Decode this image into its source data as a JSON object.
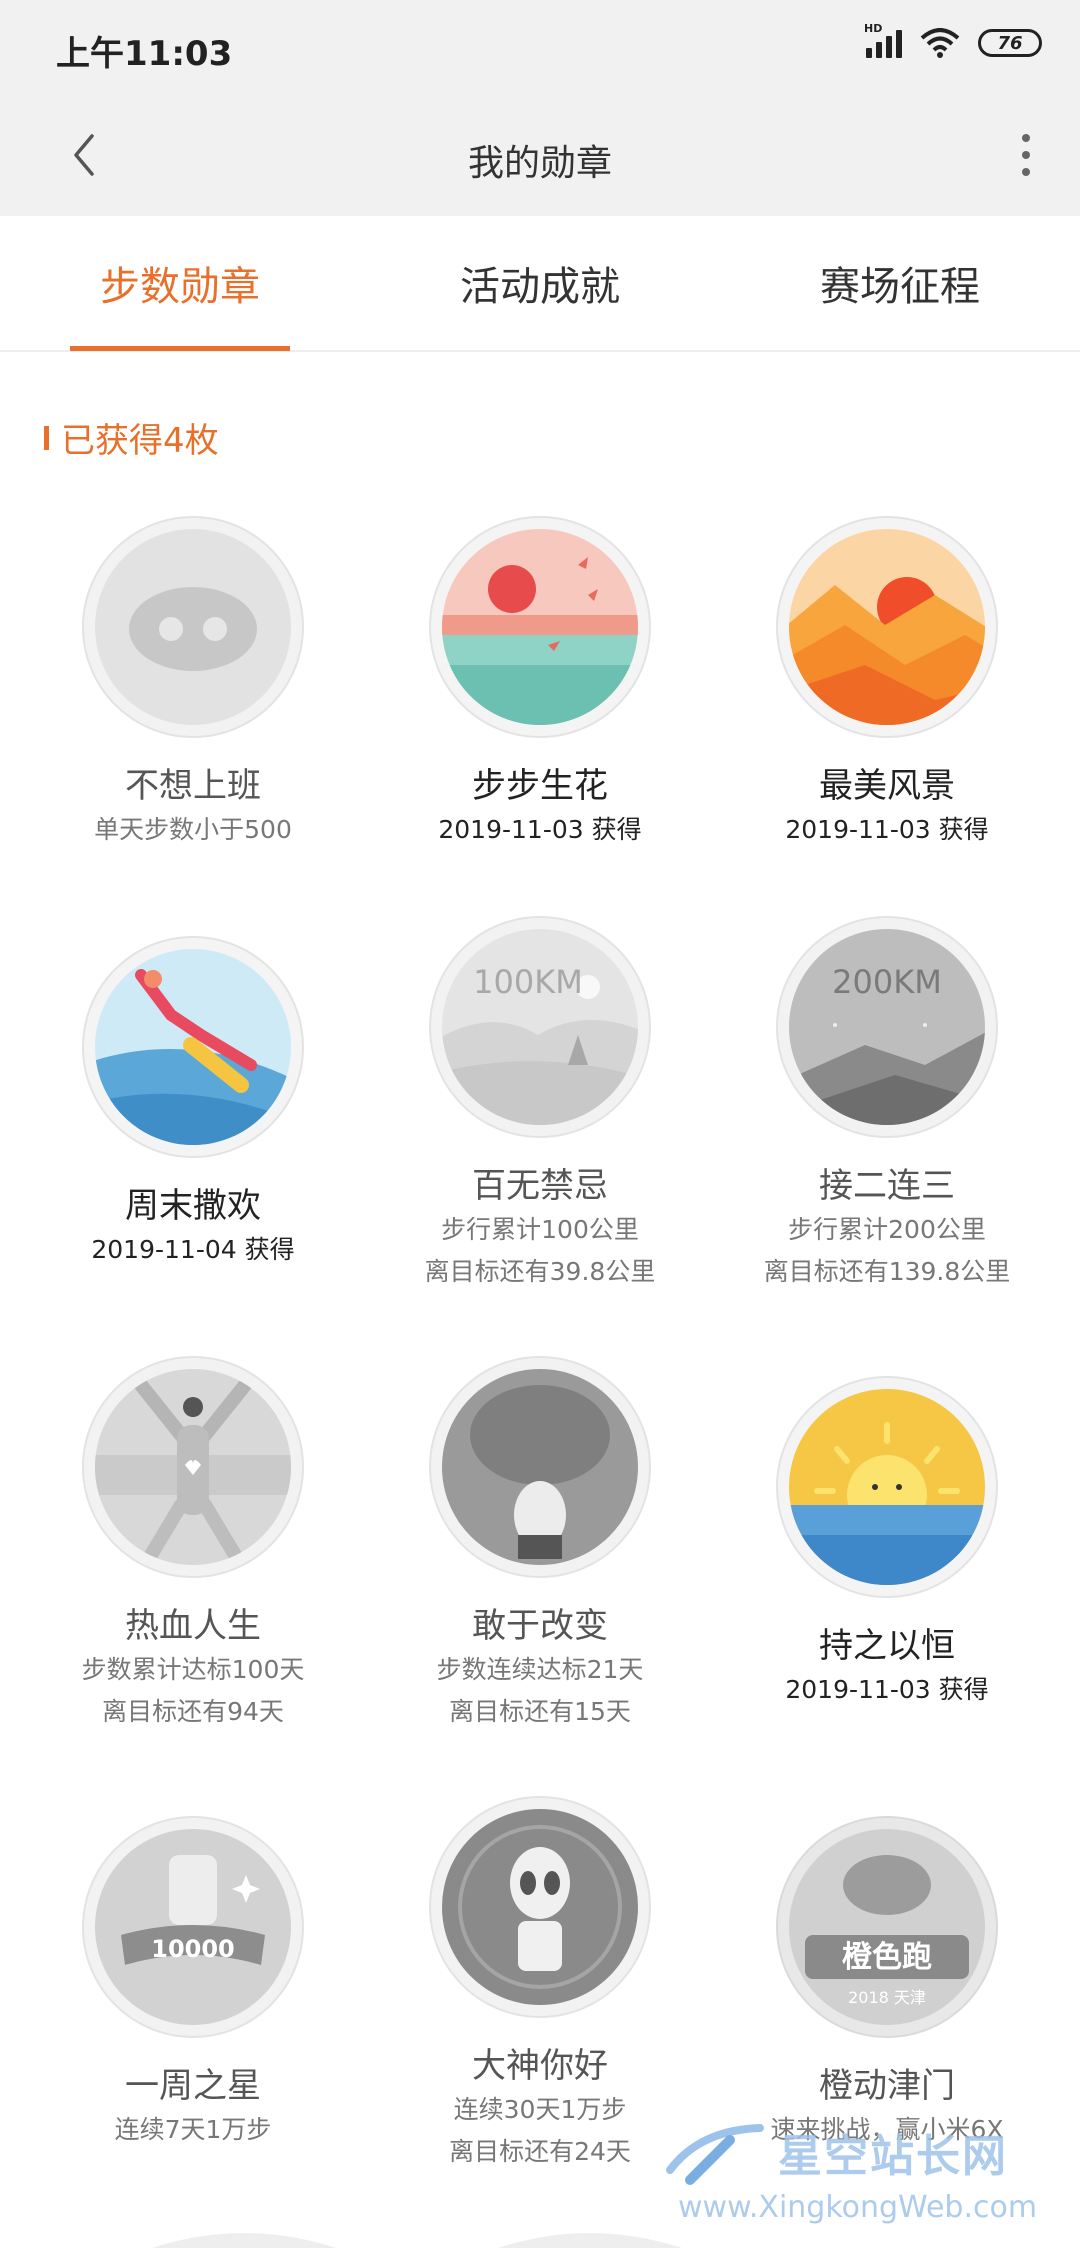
{
  "status_bar": {
    "time": "上午11:03",
    "battery": "76",
    "network": "HD"
  },
  "nav": {
    "title": "我的勋章"
  },
  "tabs": [
    {
      "label": "步数勋章",
      "active": true
    },
    {
      "label": "活动成就",
      "active": false
    },
    {
      "label": "赛场征程",
      "active": false
    }
  ],
  "section": {
    "title": "已获得4枚"
  },
  "medals": [
    {
      "name": "不想上班",
      "line1": "单天步数小于500",
      "line2": "",
      "earned": false,
      "icon": "pig-icon"
    },
    {
      "name": "步步生花",
      "line1": "2019-11-03 获得",
      "line2": "",
      "earned": true,
      "icon": "sunset-sea-icon"
    },
    {
      "name": "最美风景",
      "line1": "2019-11-03 获得",
      "line2": "",
      "earned": true,
      "icon": "mountain-sunrise-icon"
    },
    {
      "name": "周末撒欢",
      "line1": "2019-11-04 获得",
      "line2": "",
      "earned": true,
      "icon": "jumping-runner-icon"
    },
    {
      "name": "百无禁忌",
      "line1": "步行累计100公里",
      "line2": "离目标还有39.8公里",
      "earned": false,
      "icon": "landscape-100km-icon",
      "badge_text": "100KM"
    },
    {
      "name": "接二连三",
      "line1": "步行累计200公里",
      "line2": "离目标还有139.8公里",
      "earned": false,
      "icon": "night-mountain-200km-icon",
      "badge_text": "200KM"
    },
    {
      "name": "热血人生",
      "line1": "步数累计达标100天",
      "line2": "离目标还有94天",
      "earned": false,
      "icon": "heart-figure-icon"
    },
    {
      "name": "敢于改变",
      "line1": "步数连续达标21天",
      "line2": "离目标还有15天",
      "earned": false,
      "icon": "bear-icon"
    },
    {
      "name": "持之以恒",
      "line1": "2019-11-03 获得",
      "line2": "",
      "earned": true,
      "icon": "sun-sea-icon"
    },
    {
      "name": "一周之星",
      "line1": "连续7天1万步",
      "line2": "",
      "earned": false,
      "icon": "star-10000-icon",
      "badge_text": "10000"
    },
    {
      "name": "大神你好",
      "line1": "连续30天1万步",
      "line2": "离目标还有24天",
      "earned": false,
      "icon": "alien-icon"
    },
    {
      "name": "橙动津门",
      "line1": "速来挑战，赢小米6X",
      "line2": "",
      "earned": false,
      "icon": "orange-run-tianjin-icon",
      "badge_text": "橙色跑",
      "badge_sub": "2018 天津"
    }
  ],
  "watermark": {
    "title": "星空站长网",
    "url": "www.XingkongWeb.com"
  }
}
